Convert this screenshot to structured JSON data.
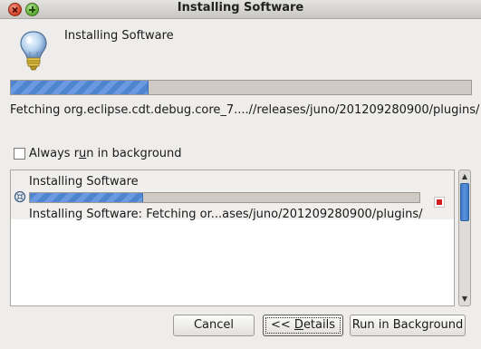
{
  "window": {
    "title": "Installing Software"
  },
  "header": {
    "title": "Installing Software",
    "icon": "lightbulb-icon"
  },
  "main_progress": {
    "fraction": 0.3
  },
  "status_text": "Fetching org.eclipse.cdt.debug.core_7....//releases/juno/201209280900/plugins/",
  "checkbox": {
    "prefix": "Always r",
    "mnemonic": "u",
    "suffix": "n in background",
    "checked": false
  },
  "task": {
    "title": "Installing Software",
    "progress_fraction": 0.29,
    "status": "Installing Software: Fetching or...ases/juno/201209280900/plugins/",
    "icon": "install-task-icon",
    "stop_icon": "stop-icon"
  },
  "buttons": {
    "cancel": "Cancel",
    "details_prefix": "<< ",
    "details_mnemonic": "D",
    "details_suffix": "etails",
    "run_background": "Run in Background"
  }
}
